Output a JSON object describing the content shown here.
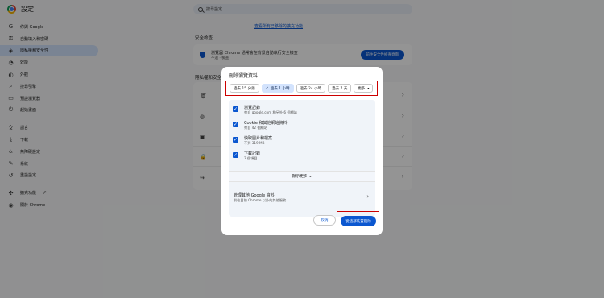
{
  "app": {
    "title": "設定"
  },
  "search": {
    "placeholder": "搜尋設定"
  },
  "sidebar": {
    "items": [
      {
        "label": "你與 Google",
        "icon": "google-icon"
      },
      {
        "label": "自動填入和密碼",
        "icon": "key-icon"
      },
      {
        "label": "隱私權和安全性",
        "icon": "shield-icon",
        "active": true
      },
      {
        "label": "效能",
        "icon": "gauge-icon"
      },
      {
        "label": "外觀",
        "icon": "palette-icon"
      },
      {
        "label": "搜尋引擎",
        "icon": "search-icon"
      },
      {
        "label": "預設瀏覽器",
        "icon": "browser-icon"
      },
      {
        "label": "起始畫面",
        "icon": "power-icon"
      },
      {
        "label": "語言",
        "icon": "translate-icon"
      },
      {
        "label": "下載",
        "icon": "download-icon"
      },
      {
        "label": "無障礙設定",
        "icon": "accessibility-icon"
      },
      {
        "label": "系統",
        "icon": "wrench-icon"
      },
      {
        "label": "重設設定",
        "icon": "reset-icon"
      },
      {
        "label": "擴充功能",
        "icon": "puzzle-icon"
      },
      {
        "label": "關於 Chrome",
        "icon": "chrome-icon"
      }
    ]
  },
  "main": {
    "link": "查看所有已移除的擴充功能",
    "safety_title": "安全檢查",
    "safety_card": {
      "line1": "瀏覽器 Chrome 通常會在背景自動執行安全檢查",
      "line2": "不過 · 檢查",
      "button": "前往安全性檢查頁面"
    },
    "privacy_title": "隱私權和安全性"
  },
  "dialog": {
    "title": "刪除瀏覽資料",
    "time_ranges": [
      {
        "label": "過去 15 分鐘",
        "selected": false
      },
      {
        "label": "過去 1 小時",
        "selected": true
      },
      {
        "label": "過去 24 小時",
        "selected": false
      },
      {
        "label": "過去 7 天",
        "selected": false
      },
      {
        "label": "更多",
        "selected": false
      }
    ],
    "items": [
      {
        "label": "瀏覽記錄",
        "sub": "來自 google.com 和另外 6 個網站"
      },
      {
        "label": "Cookie 和其他網站資料",
        "sub": "來自 42 個網站"
      },
      {
        "label": "快取圖片和檔案",
        "sub": "不到 319 MB"
      },
      {
        "label": "下載記錄",
        "sub": "2 個項目"
      }
    ],
    "more_label": "顯示更多",
    "manage": {
      "label": "管理其他 Google 資料",
      "sub": "前往目前 Chrome 以外的其他服務"
    },
    "cancel": "取消",
    "delete": "從這部裝置刪除"
  },
  "colors": {
    "accent": "#0b57d0",
    "highlight_box": "#cc0000"
  }
}
